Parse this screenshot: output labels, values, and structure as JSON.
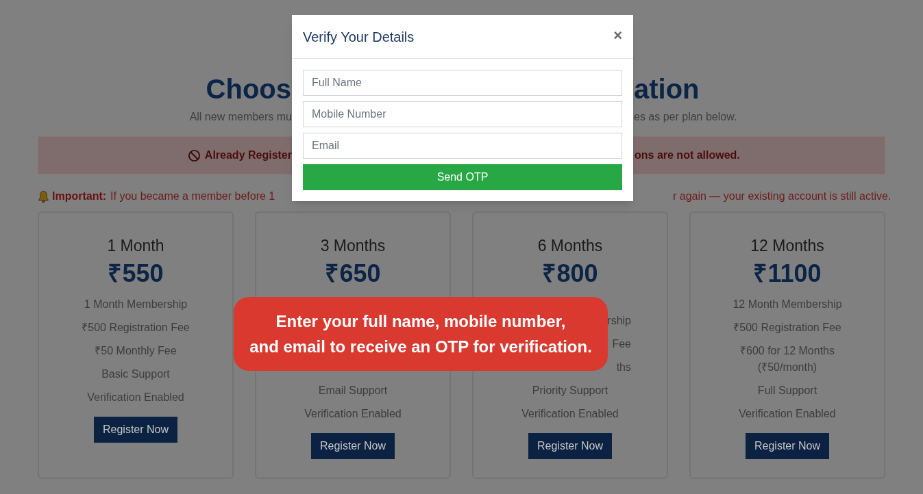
{
  "heading": {
    "left": "Choos",
    "right": "ation"
  },
  "subtitle": {
    "left": "All new members mu",
    "right": "es as per plan below."
  },
  "alert": {
    "left": "Already Register",
    "right": "ons are not allowed."
  },
  "notice": {
    "label": "Important:",
    "left": "If you became a member before 1",
    "right": "r again — your existing account is still active."
  },
  "plans": [
    {
      "title": "1 Month",
      "price": "₹550",
      "features": [
        {
          "text": "1 Month Membership"
        },
        {
          "text": "₹500 Registration Fee"
        },
        {
          "text": "₹50 Monthly Fee"
        },
        {
          "text": "Basic Support"
        },
        {
          "text": "Verification Enabled"
        }
      ],
      "button": "Register Now"
    },
    {
      "title": "3 Months",
      "price": "₹650",
      "covered": true,
      "features": [
        {
          "text": "Email Support"
        },
        {
          "text": "Verification Enabled"
        }
      ],
      "button": "Register Now"
    },
    {
      "title": "6 Months",
      "price": "₹800",
      "covered": true,
      "features": [
        {
          "text": "rship",
          "clipped": true
        },
        {
          "text": "Fee",
          "clipped": true
        },
        {
          "text": "ths",
          "clipped": true
        },
        {
          "text": "Priority Support"
        },
        {
          "text": "Verification Enabled"
        }
      ],
      "button": "Register Now"
    },
    {
      "title": "12 Months",
      "price": "₹1100",
      "features": [
        {
          "text": "12 Month Membership"
        },
        {
          "text": "₹500 Registration Fee"
        },
        {
          "text": "₹600 for 12 Months\n(₹50/month)"
        },
        {
          "text": "Full Support"
        },
        {
          "text": "Verification Enabled"
        }
      ],
      "button": "Register Now"
    }
  ],
  "modal": {
    "title": "Verify Your Details",
    "close": "×",
    "fields": [
      {
        "placeholder": "Full Name"
      },
      {
        "placeholder": "Mobile Number"
      },
      {
        "placeholder": "Email"
      }
    ],
    "submit": "Send OTP"
  },
  "callout": "Enter your full name, mobile number,\nand email to receive an OTP for verification."
}
